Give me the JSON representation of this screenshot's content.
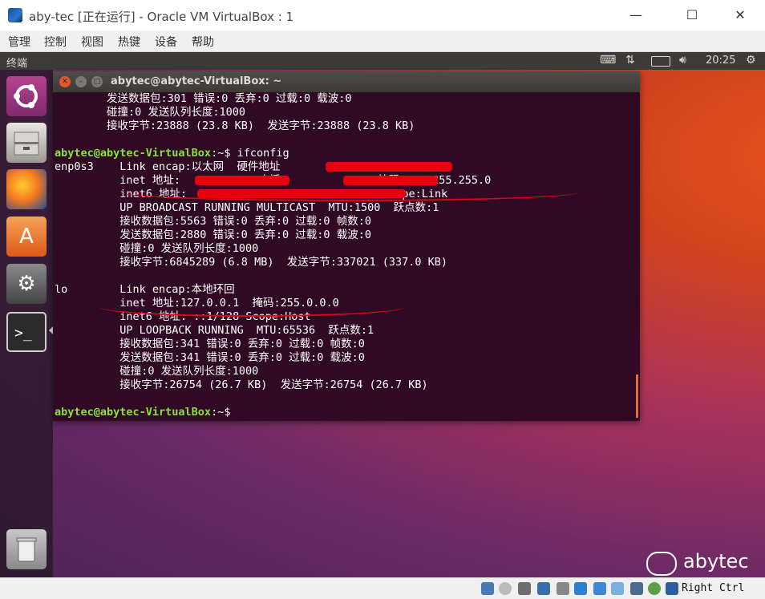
{
  "window": {
    "title": "aby-tec [正在运行] - Oracle VM VirtualBox : 1",
    "minimize": "—",
    "maximize": "☐",
    "close": "✕"
  },
  "menu": [
    "管理",
    "控制",
    "视图",
    "热键",
    "设备",
    "帮助"
  ],
  "ubuntu_topbar": {
    "app_name": "终端",
    "time": "20:25",
    "indicators": [
      "keyboard-icon",
      "network-arrows-icon",
      "battery-icon",
      "volume-icon",
      "gear-icon"
    ]
  },
  "launcher": [
    "ubuntu-dash-icon",
    "files-icon",
    "firefox-icon",
    "software-center-icon",
    "system-settings-icon",
    "terminal-icon",
    "trash-icon"
  ],
  "terminal": {
    "title": "abytec@abytec-VirtualBox: ~",
    "prompt_user": "abytec@abytec-VirtualBox",
    "prompt_path": ":~$",
    "command": " ifconfig",
    "lines": [
      "        发送数据包:301 错误:0 丢弃:0 过载:0 载波:0",
      "        碰撞:0 发送队列长度:1000",
      "        接收字节:23888 (23.8 KB)  发送字节:23888 (23.8 KB)",
      "",
      "",
      "enp0s3    Link encap:以太网  硬件地址",
      "          inet 地址:            广播:              掩码:255.255.255.0",
      "          inet6 地址:                              Scope:Link",
      "          UP BROADCAST RUNNING MULTICAST  MTU:1500  跃点数:1",
      "          接收数据包:5563 错误:0 丢弃:0 过载:0 帧数:0",
      "          发送数据包:2880 错误:0 丢弃:0 过载:0 载波:0",
      "          碰撞:0 发送队列长度:1000",
      "          接收字节:6845289 (6.8 MB)  发送字节:337021 (337.0 KB)",
      "",
      "lo        Link encap:本地环回",
      "          inet 地址:127.0.0.1  掩码:255.0.0.0",
      "          inet6 地址: ::1/128 Scope:Host",
      "          UP LOOPBACK RUNNING  MTU:65536  跃点数:1",
      "          接收数据包:341 错误:0 丢弃:0 过载:0 帧数:0",
      "          发送数据包:341 错误:0 丢弃:0 过载:0 载波:0",
      "          碰撞:0 发送队列长度:1000",
      "          接收字节:26754 (26.7 KB)  发送字节:26754 (26.7 KB)",
      ""
    ],
    "colors": {
      "background": "#300a24",
      "prompt": "#8ae234",
      "text": "#ffffff"
    }
  },
  "watermark": "abytec",
  "status_bar": {
    "host_key": "Right Ctrl",
    "icons": [
      "hdd-icon",
      "optical-drive-icon",
      "audio-icon",
      "network-icon",
      "usb-icon",
      "shared-folder-icon",
      "display-icon",
      "video-capture-icon",
      "cpu-icon",
      "mouse-integration-icon",
      "keyboard-capture-icon"
    ]
  }
}
